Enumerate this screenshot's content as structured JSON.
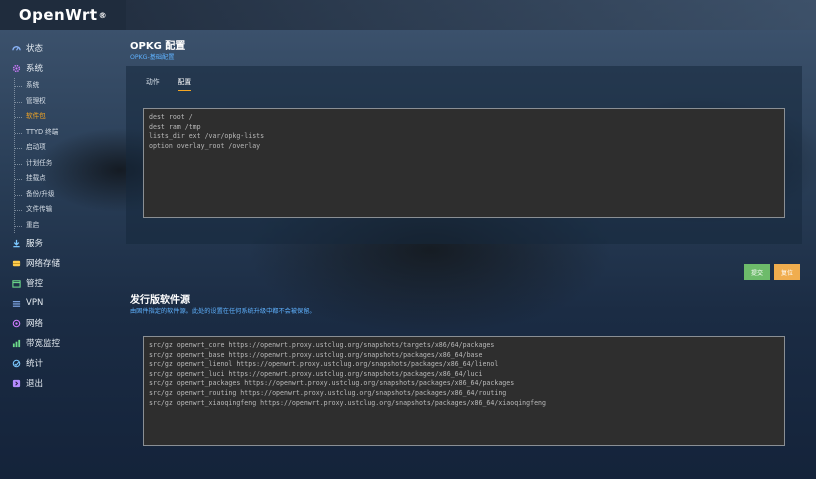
{
  "app": {
    "logo_text": "OpenWrt",
    "logo_mark": "®"
  },
  "sidebar": {
    "items": [
      {
        "label": "状态",
        "icon": "dashboard-icon",
        "color": "#8ab4f8"
      },
      {
        "label": "系统",
        "icon": "gear-icon",
        "color": "#d07cff",
        "children": [
          "系统",
          "管理权",
          "软件包",
          "TTYD 终端",
          "启动项",
          "计划任务",
          "挂载点",
          "备份/升级",
          "文件传输",
          "重启"
        ],
        "active_child": "软件包"
      },
      {
        "label": "服务",
        "icon": "download-icon",
        "color": "#7cc8ff"
      },
      {
        "label": "网络存储",
        "icon": "storage-icon",
        "color": "#ffcc4d"
      },
      {
        "label": "管控",
        "icon": "calendar-icon",
        "color": "#6ddc8b"
      },
      {
        "label": "VPN",
        "icon": "vpn-icon",
        "color": "#8ab4f8"
      },
      {
        "label": "网络",
        "icon": "network-icon",
        "color": "#d07cff"
      },
      {
        "label": "带宽监控",
        "icon": "chart-icon",
        "color": "#6ddc8b"
      },
      {
        "label": "统计",
        "icon": "stats-icon",
        "color": "#7cc8ff"
      },
      {
        "label": "退出",
        "icon": "logout-icon",
        "color": "#b58cff"
      }
    ]
  },
  "main": {
    "title": "OPKG 配置",
    "subtitle": "OPKG-基础配置",
    "tabs": [
      {
        "label": "动作"
      },
      {
        "label": "配置"
      }
    ],
    "active_tab": "配置",
    "config_text": "dest root /\ndest ram /tmp\nlists_dir ext /var/opkg-lists\noption overlay_root /overlay",
    "buttons": {
      "submit": "提交",
      "reset": "复位"
    },
    "section2_title": "发行版软件源",
    "section2_subtitle": "由固件指定的软件源。此处的设置在任何系统升级中都不会被保留。",
    "feeds_text": "src/gz openwrt_core https://openwrt.proxy.ustclug.org/snapshots/targets/x86/64/packages\nsrc/gz openwrt_base https://openwrt.proxy.ustclug.org/snapshots/packages/x86_64/base\nsrc/gz openwrt_lienol https://openwrt.proxy.ustclug.org/snapshots/packages/x86_64/lienol\nsrc/gz openwrt_luci https://openwrt.proxy.ustclug.org/snapshots/packages/x86_64/luci\nsrc/gz openwrt_packages https://openwrt.proxy.ustclug.org/snapshots/packages/x86_64/packages\nsrc/gz openwrt_routing https://openwrt.proxy.ustclug.org/snapshots/packages/x86_64/routing\nsrc/gz openwrt_xiaoqingfeng https://openwrt.proxy.ustclug.org/snapshots/packages/x86_64/xiaoqingfeng"
  },
  "colors": {
    "accent": "#f5a623",
    "link": "#5fb2ff",
    "submit": "#6dbb6a",
    "reset": "#f0ad4e"
  }
}
